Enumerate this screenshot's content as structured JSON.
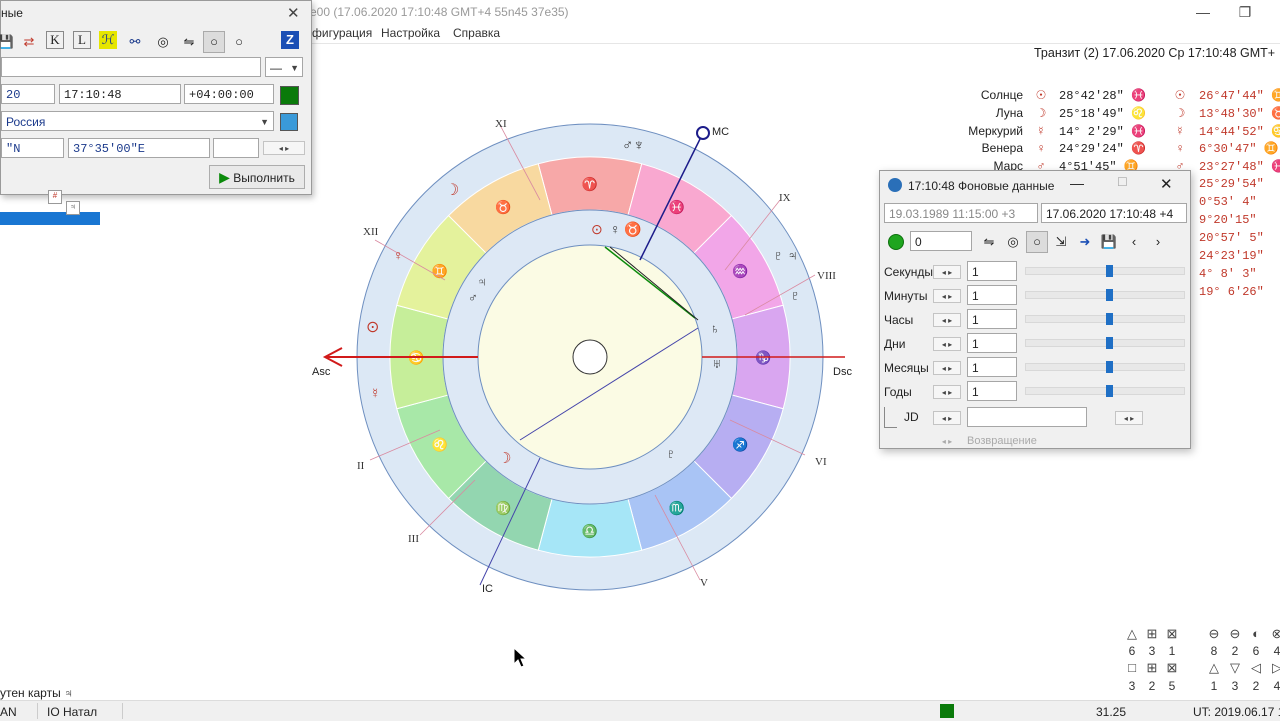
{
  "window": {
    "title": "е00  (17.06.2020  17:10:48 GMT+4 55n45 37e35)",
    "minimize": "—",
    "restore": "❐"
  },
  "menu": [
    "фигурация",
    "Настройка",
    "Справка"
  ],
  "transit_header": "Транзит (2) 17.06.2020  Ср 17:10:48 GMT+",
  "planets": [
    {
      "name": "Солнце",
      "sym": "☉",
      "val": "28°42'28\" ♓",
      "sym2": "☉",
      "val2": "26°47'44\" ♊"
    },
    {
      "name": "Луна",
      "sym": "☽",
      "val": "25°18'49\" ♌",
      "sym2": "☽",
      "val2": "13°48'30\" ♉"
    },
    {
      "name": "Меркурий",
      "sym": "☿",
      "val": "14° 2'29\" ♓",
      "sym2": "☿",
      "val2": "14°44'52\" ♋"
    },
    {
      "name": "Венера",
      "sym": "♀",
      "val": "24°29'24\" ♈",
      "sym2": "♀",
      "val2": "6°30'47\" ♊"
    },
    {
      "name": "Марс",
      "sym": "♂",
      "val": "4°51'45\" ♊",
      "sym2": "♂",
      "val2": "23°27'48\" ♓"
    }
  ],
  "planets_extra_right": [
    "25°29'54\"",
    "0°53' 4\"",
    "9°20'15\"",
    "20°57' 5\"",
    "24°23'19\"",
    "4° 8' 3\"",
    "19° 6'26\""
  ],
  "dialog_left": {
    "title": "ные",
    "toolbar": [
      "💾",
      "⇄",
      "K",
      "L",
      "ℋ",
      "⚯",
      "◎",
      "⇋",
      "○",
      "○",
      "Z"
    ],
    "name_value": "",
    "dash_select": "—",
    "date_value": "20",
    "time_value": "17:10:48",
    "tz_value": "+04:00:00",
    "place_value": "Россия",
    "lat_value": "\"N",
    "lon_value": "37°35'00\"E",
    "run_label": "Выполнить"
  },
  "dialog_right": {
    "title": "17:10:48 Фоновые данные",
    "natal_date": "19.03.1989 11:15:00 +3",
    "transit_date": "17.06.2020  17:10:48 +4",
    "counter_value": "0",
    "rows": [
      {
        "label": "Секунды",
        "value": "1",
        "level": 0.52
      },
      {
        "label": "Минуты",
        "value": "1",
        "level": 0.52
      },
      {
        "label": "Часы",
        "value": "1",
        "level": 0.52
      },
      {
        "label": "Дни",
        "value": "1",
        "level": 0.52
      },
      {
        "label": "Месяцы",
        "value": "1",
        "level": 0.52
      },
      {
        "label": "Годы",
        "value": "1",
        "level": 0.52
      }
    ],
    "jd_label": "JD",
    "return_label": "Возвращение"
  },
  "chart": {
    "houses": [
      "XI",
      "XII",
      "II",
      "III",
      "IX",
      "VIII",
      "VI",
      "V"
    ],
    "axes": {
      "asc": "Asc",
      "dsc": "Dsc",
      "mc": "MC",
      "ic": "IC"
    }
  },
  "bottom_icons": {
    "row1_nums": [
      "6",
      "3",
      "1",
      "8",
      "2",
      "6",
      "4"
    ],
    "row2_nums": [
      "3",
      "2",
      "5",
      "1",
      "3",
      "2",
      "4"
    ]
  },
  "left_label": "утен карты  ♃",
  "status": {
    "left1": "AN",
    "left2": "IO Натал",
    "value": "31.25",
    "ut": "UT: 2019.06.17 14"
  }
}
